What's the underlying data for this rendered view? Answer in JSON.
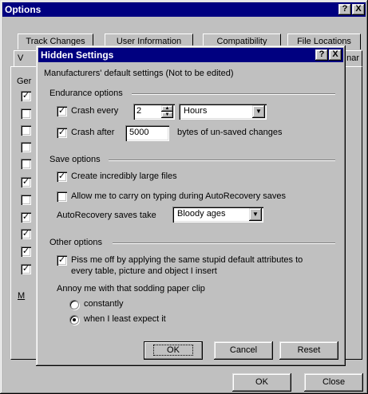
{
  "options_window": {
    "title": "Options",
    "help_btn": "?",
    "close_btn": "X",
    "tabs_row1": [
      "Track Changes",
      "User Information",
      "Compatibility",
      "File Locations"
    ],
    "tab_row2_left": "V",
    "tab_row2_right": "nar",
    "general_label": "Ger",
    "m_label": "M",
    "ok_label": "OK",
    "close_label": "Close",
    "left_checkboxes": [
      true,
      false,
      false,
      false,
      false,
      true,
      false,
      true,
      true,
      true,
      true
    ]
  },
  "hidden": {
    "title": "Hidden Settings",
    "help_btn": "?",
    "close_btn": "X",
    "intro": "Manufacturers' default settings   (Not to be edited)",
    "endurance": {
      "group": "Endurance options",
      "crash_every_label": "Crash every",
      "crash_every_checked": true,
      "crash_every_value": "2",
      "crash_every_unit": "Hours",
      "crash_after_label": "Crash after",
      "crash_after_checked": true,
      "crash_after_value": "5000",
      "crash_after_suffix": "bytes of un-saved changes"
    },
    "save": {
      "group": "Save options",
      "large_files_label": "Create incredibly large files",
      "large_files_checked": true,
      "carry_on_label": "Allow me to carry on typing during AutoRecovery saves",
      "carry_on_checked": false,
      "autorecovery_label": "AutoRecovery saves take",
      "autorecovery_value": "Bloody ages"
    },
    "other": {
      "group": "Other options",
      "piss_line1": "Piss me off by applying the same stupid default attributes to",
      "piss_line2": "every table, picture and object I insert",
      "piss_checked": true,
      "annoy_label": "Annoy me with that sodding paper clip",
      "radio_constantly": "constantly",
      "radio_least": "when I least expect it",
      "selected": "when I least expect it"
    },
    "buttons": {
      "ok": "OK",
      "cancel": "Cancel",
      "reset": "Reset"
    }
  }
}
